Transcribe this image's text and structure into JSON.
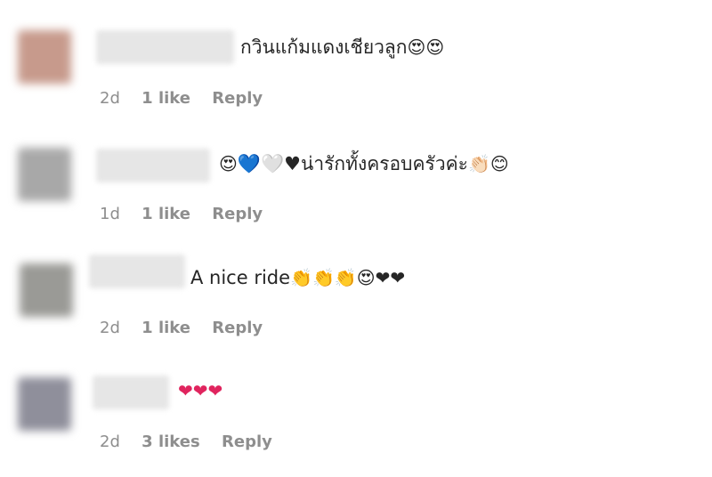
{
  "comments": [
    {
      "text": "กวินแก้มแดงเชียวลูก",
      "emojis": "😍😍",
      "time": "2d",
      "likes": "1 like",
      "reply": "Reply",
      "avatar_color": "#c79a8c"
    },
    {
      "text": "💙🤍♥น่ารักทั้งครอบครัวค่ะ",
      "emojis_pre": "😍",
      "emojis": "👏🏻😊",
      "time": "1d",
      "likes": "1 like",
      "reply": "Reply",
      "avatar_color": "#a8a8a8"
    },
    {
      "text": "A nice ride",
      "emojis": "👏👏👏😍❤❤",
      "time": "2d",
      "likes": "1 like",
      "reply": "Reply",
      "avatar_color": "#9a9a96"
    },
    {
      "text": "",
      "emojis": "❤❤❤",
      "time": "2d",
      "likes": "3 likes",
      "reply": "Reply",
      "avatar_color": "#8f8f9b"
    }
  ]
}
